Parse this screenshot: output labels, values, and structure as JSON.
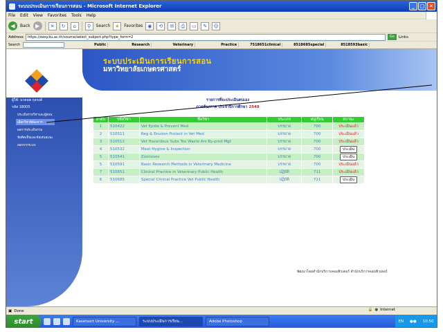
{
  "window": {
    "title": "ระบบประเมินการเรียนการสอน - Microsoft Internet Explorer"
  },
  "menubar": [
    "File",
    "Edit",
    "View",
    "Favorites",
    "Tools",
    "Help"
  ],
  "toolbar": {
    "back_label": "Back",
    "search_label": "Search",
    "favorites_label": "Favorites"
  },
  "address": {
    "label": "Address",
    "url": "https://easy.ku.ac.th/source/select_subject.php?type_form=2",
    "go_label": "Go",
    "links_label": "Links"
  },
  "links_bar": {
    "search_label": "Search",
    "tabs": [
      "Public",
      "Research",
      "Veterinary",
      "Practice",
      "7518651clinical",
      "8518685special",
      "8518593basic"
    ]
  },
  "banner": {
    "title": "ระบบประเมินการเรียนการสอน",
    "subtitle": "มหาวิทยาลัยเกษตรศาสตร์"
  },
  "user": {
    "name": "ผู้ใช้: นายนพ กุลรงค์",
    "code": "รหัส 18005"
  },
  "sidebar_menu": [
    {
      "label": "ประเมินรายวิชาและผู้สอน",
      "active": false
    },
    {
      "label": "เลือกวิชาที่ต้องการ",
      "active": true
    },
    {
      "label": "ผลการประเมินรวม",
      "active": false
    },
    {
      "label": "ข้อคิดเห็นและข้อเสนอแนะ",
      "active": false
    },
    {
      "label": "ออกจากระบบ",
      "active": false
    }
  ],
  "heading": {
    "line1": "รายการที่จะประเมินตนเอง",
    "line2_prefix": "ภาคต้น/ภาค ประจำปีการศึกษา",
    "year": "2548"
  },
  "table": {
    "headers": [
      "ลำดับ",
      "รหัสวิชา",
      "ชื่อวิชา",
      "ประเภท",
      "หมู่เรียน",
      "สถานะ"
    ],
    "rows": [
      {
        "no": "1",
        "code": "510422",
        "name": "Vet Epide & Prevent Med",
        "type": "บรรยาย",
        "sec": "700",
        "status": "ประเมินแล้ว",
        "button": false
      },
      {
        "no": "2",
        "code": "510511",
        "name": "Reg & Environ Protect in Vet Med",
        "type": "บรรยาย",
        "sec": "700",
        "status": "ประเมินแล้ว",
        "button": false
      },
      {
        "no": "3",
        "code": "510512",
        "name": "Vet Hazardous Subs Tox Waste Ani By-prod Mgt",
        "type": "บรรยาย",
        "sec": "700",
        "status": "ประเมินแล้ว",
        "button": false
      },
      {
        "no": "4",
        "code": "510532",
        "name": "Meat Hygine & Inspection",
        "type": "บรรยาย",
        "sec": "700",
        "status": "ประเมิน",
        "button": true
      },
      {
        "no": "5",
        "code": "510541",
        "name": "Zoonoses",
        "type": "บรรยาย",
        "sec": "700",
        "status": "ประเมิน",
        "button": true
      },
      {
        "no": "5",
        "code": "510591",
        "name": "Basic Research Methods in Veterinary Medicine",
        "type": "บรรยาย",
        "sec": "700",
        "status": "ประเมินแล้ว",
        "button": false
      },
      {
        "no": "7",
        "code": "510651",
        "name": "Clinical Practice in Veterinary Public Health",
        "type": "ปฏิบัติ",
        "sec": "711",
        "status": "ประเมินแล้ว",
        "button": false
      },
      {
        "no": "6",
        "code": "510685",
        "name": "Special Clinical Practice Vet Public Health",
        "type": "ปฏิบัติ",
        "sec": "711",
        "status": "ประเมิน",
        "button": true
      }
    ]
  },
  "footer_text": "พัฒนาโดยสำนักบริการคอมพิวเตอร์ สำนักบริการคอมพิวเตอร์",
  "statusbar": {
    "left": "Done",
    "zone": "Internet"
  },
  "taskbar": {
    "start_label": "start",
    "items": [
      {
        "label": "Kasetsart University ...",
        "active": false
      },
      {
        "label": "ระบบประเมินการเรียน...",
        "active": true
      },
      {
        "label": "Adobe Photoshop",
        "active": false
      }
    ],
    "lang": "EN",
    "clock": "10:50"
  }
}
